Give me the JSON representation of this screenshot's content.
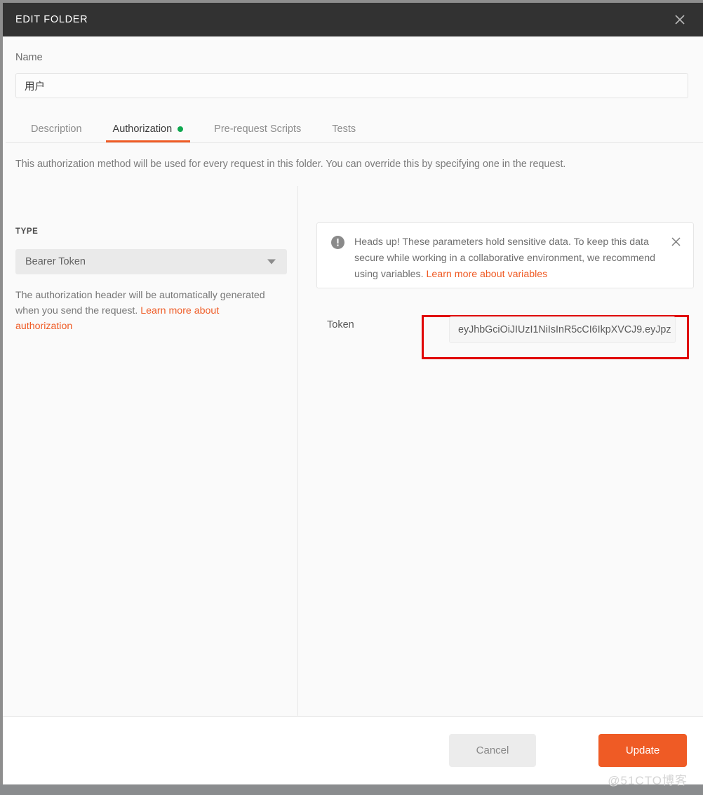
{
  "window": {
    "title": "EDIT FOLDER",
    "close_icon": "close-icon"
  },
  "name_field": {
    "label": "Name",
    "value": "用户",
    "placeholder": "Name"
  },
  "tabs": [
    {
      "label": "Description",
      "active": false,
      "dot": false
    },
    {
      "label": "Authorization",
      "active": true,
      "dot": true
    },
    {
      "label": "Pre-request Scripts",
      "active": false,
      "dot": false
    },
    {
      "label": "Tests",
      "active": false,
      "dot": false
    }
  ],
  "helper_text": "This authorization method will be used for every request in this folder. You can override this by specifying one in the request.",
  "auth_panel": {
    "type_label": "TYPE",
    "type_value": "Bearer Token",
    "type_caret_icon": "chevron-down-icon",
    "description_text": "The authorization header will be automatically generated when you send the request. ",
    "description_link": "Learn more about authorization"
  },
  "warning_banner": {
    "icon": "exclamation-circle-icon",
    "text": "Heads up! These parameters hold sensitive data. To keep this data secure while working in a collaborative environment, we recommend using variables. ",
    "link": "Learn more about variables",
    "close_icon": "close-icon"
  },
  "token_field": {
    "label": "Token",
    "value": "eyJhbGciOiJIUzI1NiIsInR5cCI6IkpXVCJ9.eyJpz",
    "placeholder": "Token",
    "highlight_color": "#e00000"
  },
  "footer": {
    "cancel_label": "Cancel",
    "update_label": "Update"
  },
  "watermark": "@51CTO博客",
  "colors": {
    "header_bg": "#323232",
    "accent": "#ef5b25",
    "dot_green": "#0fa84f",
    "body_bg": "#fafafa",
    "highlight_red": "#e00000"
  }
}
